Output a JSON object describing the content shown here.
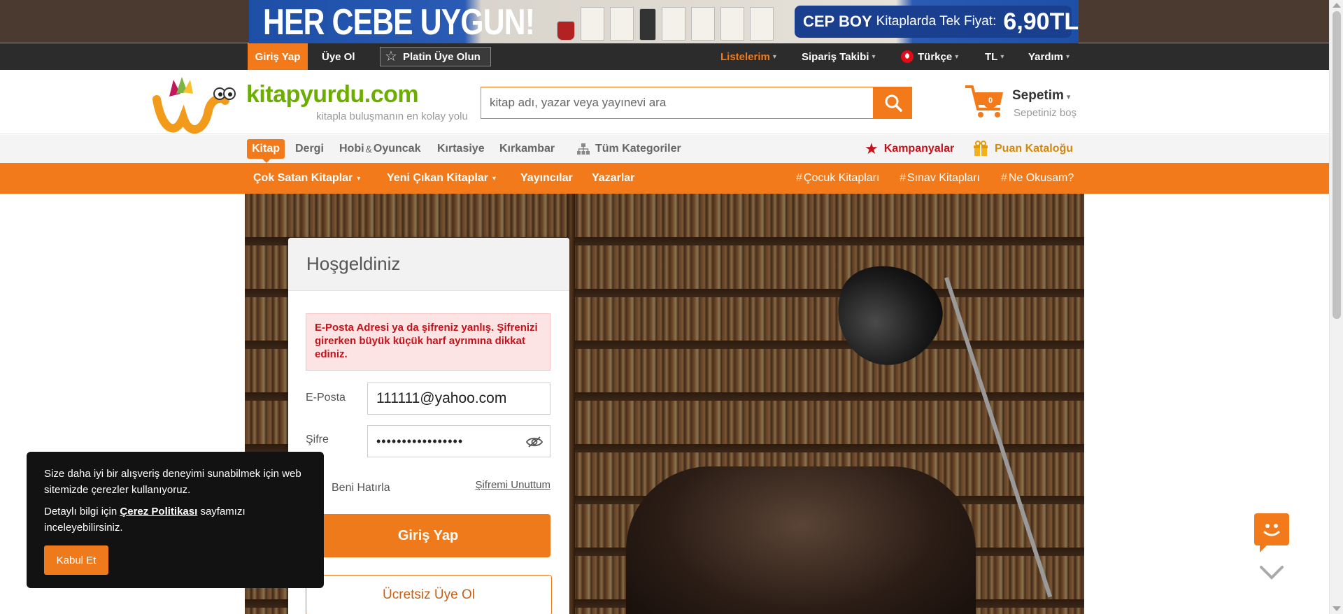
{
  "banner": {
    "headline": "HER CEBE UYGUN!",
    "offer_brand": "CEP BOY",
    "offer_text": "Kitaplarda Tek Fiyat:",
    "offer_price": "6,90TL"
  },
  "userbar": {
    "login": "Giriş Yap",
    "signup": "Üye Ol",
    "platin": "Platin Üye Olun",
    "lists": "Listelerim",
    "order_tracking": "Sipariş Takibi",
    "language": "Türkçe",
    "currency": "TL",
    "help": "Yardım"
  },
  "header": {
    "logo_text": "kitapyurdu.com",
    "logo_tagline": "kitapla buluşmanın en kolay yolu",
    "search_placeholder": "kitap adı, yazar veya yayınevi ara",
    "cart_count": "0",
    "cart_title": "Sepetim",
    "cart_status": "Sepetiniz boş"
  },
  "categories": {
    "active": "Kitap",
    "items": [
      "Dergi",
      "Hobi",
      "&",
      "Oyuncak",
      "Kırtasiye",
      "Kırkambar"
    ],
    "all": "Tüm Kategoriler",
    "campaigns": "Kampanyalar",
    "points_catalog": "Puan Kataloğu"
  },
  "orange_nav": {
    "best_sellers": "Çok Satan Kitaplar",
    "new_releases": "Yeni Çıkan Kitaplar",
    "publishers": "Yayıncılar",
    "authors": "Yazarlar",
    "tags": [
      "Çocuk Kitapları",
      "Sınav Kitapları",
      "Ne Okusam?"
    ]
  },
  "login": {
    "title": "Hoşgeldiniz",
    "error": "E-Posta Adresi ya da şifreniz yanlış. Şifrenizi girerken büyük küçük harf ayrımına dikkat ediniz.",
    "email_label": "E-Posta",
    "email_value": "111111@yahoo.com",
    "password_label": "Şifre",
    "password_mask": "•••••••••••••••••",
    "remember": "Beni Hatırla",
    "forgot": "Şifremi Unuttum",
    "submit": "Giriş Yap",
    "free_signup": "Ücretsiz Üye Ol"
  },
  "cookie": {
    "line1": "Size daha iyi bir alışveriş deneyimi sunabilmek için web sitemizde çerezler kullanıyoruz.",
    "line2_prefix": "Detaylı bilgi için",
    "line2_link": "Çerez Politikası",
    "line2_suffix": "sayfamızı inceleyebilirsiniz.",
    "accept": "Kabul Et"
  },
  "colors": {
    "accent": "#f27a1a",
    "logo_green": "#6cae00",
    "topbar": "#2c2c2c",
    "error_text": "#c5121a",
    "campaign_red": "#c5121a",
    "points_gold": "#d4880a"
  }
}
